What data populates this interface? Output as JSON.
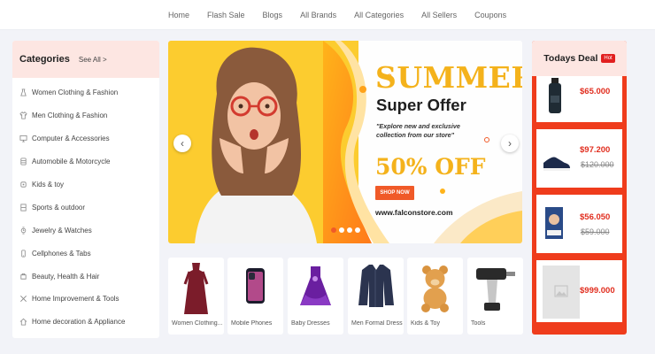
{
  "nav": {
    "items": [
      "Home",
      "Flash Sale",
      "Blogs",
      "All Brands",
      "All Categories",
      "All Sellers",
      "Coupons"
    ]
  },
  "categories": {
    "title": "Categories",
    "see_all": "See All >",
    "items": [
      {
        "label": "Women Clothing & Fashion",
        "icon": "dress-icon"
      },
      {
        "label": "Men Clothing & Fashion",
        "icon": "shirt-icon"
      },
      {
        "label": "Computer & Accessories",
        "icon": "monitor-icon"
      },
      {
        "label": "Automobile & Motorcycle",
        "icon": "car-icon"
      },
      {
        "label": "Kids & toy",
        "icon": "toy-icon"
      },
      {
        "label": "Sports & outdoor",
        "icon": "sports-icon"
      },
      {
        "label": "Jewelry & Watches",
        "icon": "watch-icon"
      },
      {
        "label": "Cellphones & Tabs",
        "icon": "phone-icon"
      },
      {
        "label": "Beauty, Health & Hair",
        "icon": "beauty-icon"
      },
      {
        "label": "Home Improvement & Tools",
        "icon": "tools-icon"
      },
      {
        "label": "Home decoration & Appliance",
        "icon": "home-icon"
      }
    ]
  },
  "banner": {
    "title1": "SUMMER",
    "title2": "Super Offer",
    "description": "\"Explore new and exclusive collection from our store\"",
    "offer": "50% OFF",
    "cta": "SHOP NOW",
    "website": "www.falconstore.com",
    "slide_count": 4,
    "active_slide": 1,
    "accent": "#f4b21b"
  },
  "products": [
    {
      "name": "Women Clothing...",
      "icon": "dress-icon"
    },
    {
      "name": "Mobile Phones",
      "icon": "phone-icon"
    },
    {
      "name": "Baby Dresses",
      "icon": "dress-icon"
    },
    {
      "name": "Men Formal Dress",
      "icon": "shirt-icon"
    },
    {
      "name": "Kids & Toy",
      "icon": "teddy-bear-icon"
    },
    {
      "name": "Tools",
      "icon": "drill-icon"
    }
  ],
  "todays_deal": {
    "title": "Todays Deal",
    "badge": "Hot",
    "items": [
      {
        "price": "$65.000",
        "old_price": "",
        "icon": "bottle-icon"
      },
      {
        "price": "$97.200",
        "old_price": "$120.000",
        "icon": "shoe-icon"
      },
      {
        "price": "$56.050",
        "old_price": "$59.000",
        "icon": "book-icon"
      },
      {
        "price": "$999.000",
        "old_price": "",
        "icon": "image-placeholder-icon"
      }
    ]
  },
  "colors": {
    "brand_red": "#ef3c1c",
    "price_red": "#e12e1f",
    "header_pink": "#fde6e2",
    "cta_orange": "#f05a28"
  }
}
